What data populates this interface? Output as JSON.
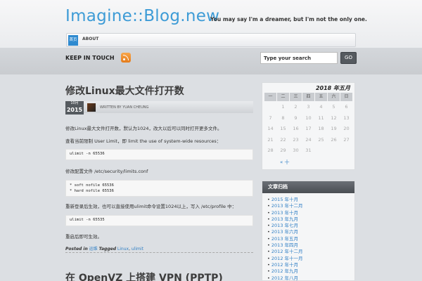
{
  "header": {
    "title": "Imagine::Blog.new",
    "tagline": "You may say I'm a dreamer, but I'm not the only one.",
    "nav": {
      "home_label": "首页",
      "about_label": "ABOUT"
    }
  },
  "subheader": {
    "keep_in_touch": "KEEP IN TOUCH",
    "search_placeholder": "Type your search",
    "search_button": "GO"
  },
  "post": {
    "title": "修改Linux最大文件打开数",
    "date_month": "10月",
    "date_year": "2015",
    "author_line": "WRITTEN BY YUAN CHEUNG",
    "para1": "修改Linux最大文件打开数，默认为1024，改大以后可以同时打开更多文件。",
    "para2": "查看当前限制 User Limit，即 limit the use of system-wide resources：",
    "code1": "ulimit -n 65536",
    "para3": "修改配置文件 /etc/security/limits.conf",
    "code2_line1": "* soft nofile 65536",
    "code2_line2": "* hard nofile 65536",
    "para4": "重新登录后生效，也可以直接使用ulimit命令设置1024以上，写入 /etc/profile 中：",
    "code3": "ulimit -n 65535",
    "para5": "重启后即可生效。",
    "posted_in_label": "Posted in",
    "category": "运维",
    "tagged_label": "Tagged",
    "tag1": "Linux",
    "tag2": "ulimit",
    "next_title": "在 OpenVZ 上搭建 VPN (PPTP)"
  },
  "calendar": {
    "caption": "2018 年五月",
    "headers": [
      "一",
      "二",
      "三",
      "四",
      "五",
      "六",
      "日"
    ],
    "rows": [
      [
        "",
        "1",
        "2",
        "3",
        "4",
        "5",
        "6"
      ],
      [
        "7",
        "8",
        "9",
        "10",
        "11",
        "12",
        "13"
      ],
      [
        "14",
        "15",
        "16",
        "17",
        "18",
        "19",
        "20"
      ],
      [
        "21",
        "22",
        "23",
        "24",
        "25",
        "26",
        "27"
      ],
      [
        "28",
        "29",
        "30",
        "31",
        "",
        "",
        ""
      ]
    ],
    "prev_label": "« 十"
  },
  "archive": {
    "heading": "文章归档",
    "items": [
      "2015 年十月",
      "2013 年十二月",
      "2013 年十月",
      "2013 年九月",
      "2013 年七月",
      "2013 年六月",
      "2013 年五月",
      "2013 年四月",
      "2012 年十二月",
      "2012 年十一月",
      "2012 年十月",
      "2012 年九月",
      "2012 年八月"
    ]
  }
}
